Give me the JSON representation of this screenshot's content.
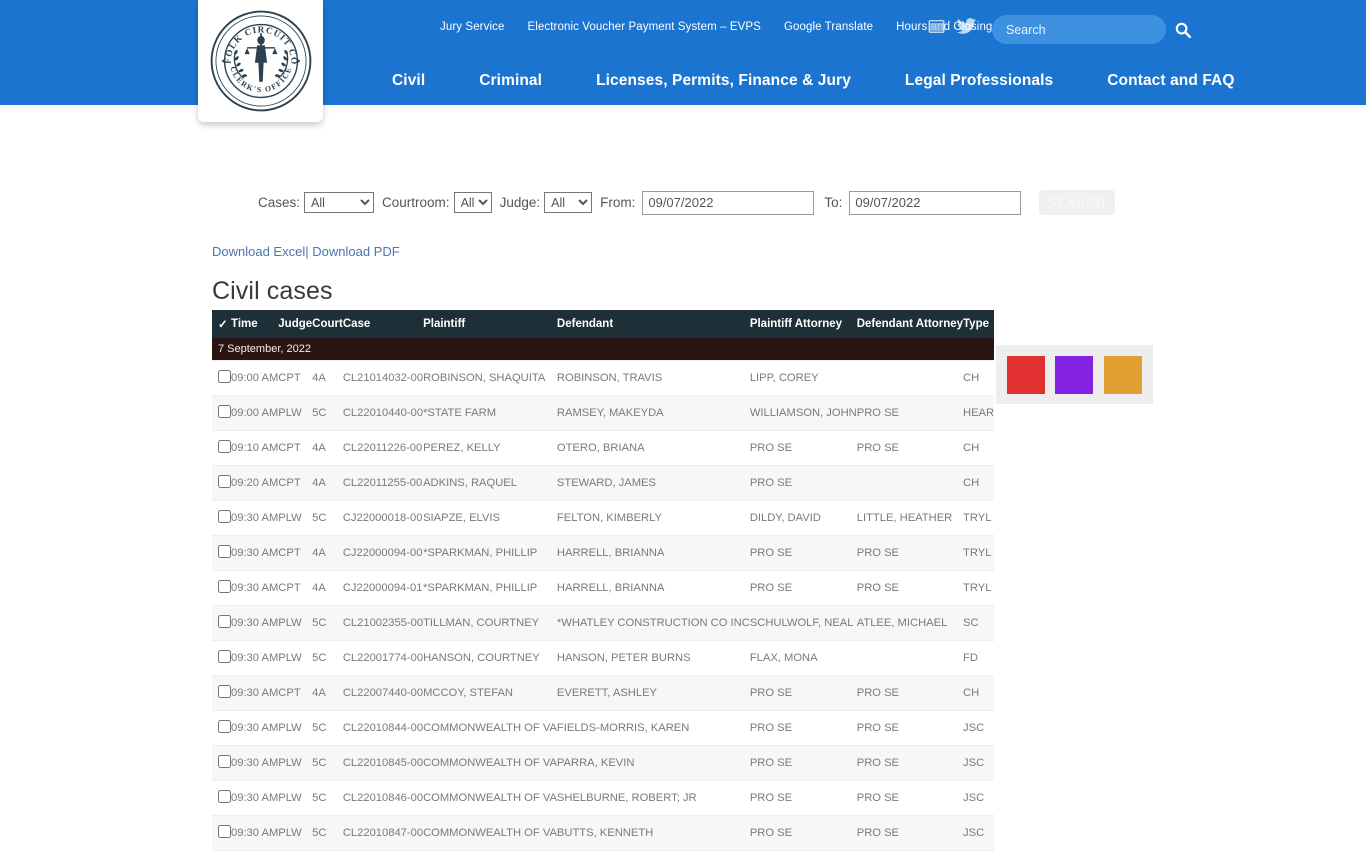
{
  "header": {
    "logo_alt": "Norfolk Circuit Court Clerk's Office seal",
    "utility_links": [
      {
        "label": "Jury Service"
      },
      {
        "label": "Electronic Voucher Payment System – EVPS"
      },
      {
        "label": "Google Translate"
      },
      {
        "label": "Hours and Closings"
      }
    ],
    "social": [
      {
        "name": "youtube-icon"
      },
      {
        "name": "twitter-icon"
      }
    ],
    "search": {
      "placeholder": "Search",
      "value": "",
      "icon": "search-icon"
    },
    "main_nav": [
      {
        "label": "Civil"
      },
      {
        "label": "Criminal"
      },
      {
        "label": "Licenses, Permits, Finance & Jury"
      },
      {
        "label": "Legal Professionals"
      },
      {
        "label": "Contact and FAQ"
      }
    ],
    "colors": {
      "header_blue": "#1b75d0",
      "search_pill": "#3e90e0"
    }
  },
  "filters": {
    "cases_label": "Cases:",
    "cases_value": "All",
    "courtroom_label": "Courtroom:",
    "courtroom_value": "All",
    "judge_label": "Judge:",
    "judge_value": "All",
    "from_label": "From:",
    "from_value": "09/07/2022",
    "to_label": "To:",
    "to_value": "09/07/2022",
    "search_button": "SEARCH",
    "options": [
      "All"
    ]
  },
  "downloads": {
    "excel": "Download Excel",
    "separator": "|",
    "pdf": "Download PDF"
  },
  "page_title": "Civil cases",
  "swatches": [
    {
      "name": "swatch-red",
      "color": "#e03030"
    },
    {
      "name": "swatch-purple",
      "color": "#8322e0"
    },
    {
      "name": "swatch-orange",
      "color": "#e0a033"
    }
  ],
  "table": {
    "columns": [
      "✓",
      "Time",
      "Judge",
      "Court",
      "Case",
      "Plaintiff",
      "Defendant",
      "Plaintiff Attorney",
      "Defendant Attorney",
      "Type"
    ],
    "date_group": "7 September, 2022",
    "header_bg": "#1d3038",
    "date_bg": "#2b1512",
    "rows": [
      {
        "time": "09:00 AM",
        "judge": "CPT",
        "court": "4A",
        "case": "CL21014032-00",
        "plaintiff": "ROBINSON, SHAQUITA",
        "defendant": "ROBINSON, TRAVIS",
        "patt": "LIPP, COREY",
        "datt": "",
        "type": "CH"
      },
      {
        "time": "09:00 AM",
        "judge": "PLW",
        "court": "5C",
        "case": "CL22010440-00",
        "plaintiff": "*STATE FARM",
        "defendant": "RAMSEY, MAKEYDA",
        "patt": "WILLIAMSON, JOHN",
        "datt": "PRO SE",
        "type": "HEAR"
      },
      {
        "time": "09:10 AM",
        "judge": "CPT",
        "court": "4A",
        "case": "CL22011226-00",
        "plaintiff": "PEREZ, KELLY",
        "defendant": "OTERO, BRIANA",
        "patt": "PRO SE",
        "datt": "PRO SE",
        "type": "CH"
      },
      {
        "time": "09:20 AM",
        "judge": "CPT",
        "court": "4A",
        "case": "CL22011255-00",
        "plaintiff": "ADKINS, RAQUEL",
        "defendant": "STEWARD, JAMES",
        "patt": "PRO SE",
        "datt": "",
        "type": "CH"
      },
      {
        "time": "09:30 AM",
        "judge": "PLW",
        "court": "5C",
        "case": "CJ22000018-00",
        "plaintiff": "SIAPZE, ELVIS",
        "defendant": "FELTON, KIMBERLY",
        "patt": "DILDY, DAVID",
        "datt": "LITTLE, HEATHER",
        "type": "TRYL"
      },
      {
        "time": "09:30 AM",
        "judge": "CPT",
        "court": "4A",
        "case": "CJ22000094-00",
        "plaintiff": "*SPARKMAN, PHILLIP",
        "defendant": "HARRELL, BRIANNA",
        "patt": "PRO SE",
        "datt": "PRO SE",
        "type": "TRYL"
      },
      {
        "time": "09:30 AM",
        "judge": "CPT",
        "court": "4A",
        "case": "CJ22000094-01",
        "plaintiff": "*SPARKMAN, PHILLIP",
        "defendant": "HARRELL, BRIANNA",
        "patt": "PRO SE",
        "datt": "PRO SE",
        "type": "TRYL"
      },
      {
        "time": "09:30 AM",
        "judge": "PLW",
        "court": "5C",
        "case": "CL21002355-00",
        "plaintiff": "TILLMAN, COURTNEY",
        "defendant": "*WHATLEY CONSTRUCTION CO INC",
        "patt": "SCHULWOLF, NEAL",
        "datt": "ATLEE, MICHAEL",
        "type": "SC"
      },
      {
        "time": "09:30 AM",
        "judge": "PLW",
        "court": "5C",
        "case": "CL22001774-00",
        "plaintiff": "HANSON, COURTNEY",
        "defendant": "HANSON, PETER BURNS",
        "patt": "FLAX, MONA",
        "datt": "",
        "type": "FD"
      },
      {
        "time": "09:30 AM",
        "judge": "CPT",
        "court": "4A",
        "case": "CL22007440-00",
        "plaintiff": "MCCOY, STEFAN",
        "defendant": "EVERETT, ASHLEY",
        "patt": "PRO SE",
        "datt": "PRO SE",
        "type": "CH"
      },
      {
        "time": "09:30 AM",
        "judge": "PLW",
        "court": "5C",
        "case": "CL22010844-00",
        "plaintiff": "COMMONWEALTH OF VA",
        "defendant": "FIELDS-MORRIS, KAREN",
        "patt": "PRO SE",
        "datt": "PRO SE",
        "type": "JSC"
      },
      {
        "time": "09:30 AM",
        "judge": "PLW",
        "court": "5C",
        "case": "CL22010845-00",
        "plaintiff": "COMMONWEALTH OF VA",
        "defendant": "PARRA, KEVIN",
        "patt": "PRO SE",
        "datt": "PRO SE",
        "type": "JSC"
      },
      {
        "time": "09:30 AM",
        "judge": "PLW",
        "court": "5C",
        "case": "CL22010846-00",
        "plaintiff": "COMMONWEALTH OF VA",
        "defendant": "SHELBURNE, ROBERT; JR",
        "patt": "PRO SE",
        "datt": "PRO SE",
        "type": "JSC"
      },
      {
        "time": "09:30 AM",
        "judge": "PLW",
        "court": "5C",
        "case": "CL22010847-00",
        "plaintiff": "COMMONWEALTH OF VA",
        "defendant": "BUTTS, KENNETH",
        "patt": "PRO SE",
        "datt": "PRO SE",
        "type": "JSC"
      }
    ]
  }
}
